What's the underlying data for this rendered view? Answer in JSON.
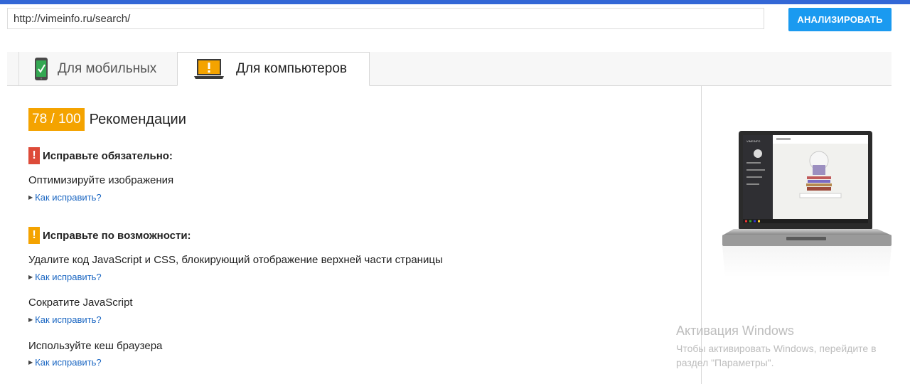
{
  "header": {
    "url_value": "http://vimeinfo.ru/search/",
    "analyze_label": "АНАЛИЗИРОВАТЬ"
  },
  "tabs": [
    {
      "label": "Для мобильных",
      "icon": "mobile-phone-check-icon",
      "active": false
    },
    {
      "label": "Для компьютеров",
      "icon": "desktop-warning-icon",
      "active": true
    }
  ],
  "score": {
    "value": "78 / 100",
    "label": "Рекомендации"
  },
  "sections": {
    "must_fix": {
      "title": "Исправьте обязательно:",
      "icon": "exclamation-icon",
      "rules": [
        {
          "title": "Оптимизируйте изображения",
          "link": "Как исправить?"
        }
      ]
    },
    "should_fix": {
      "title": "Исправьте по возможности:",
      "icon": "exclamation-icon",
      "rules": [
        {
          "title": "Удалите код JavaScript и CSS, блокирующий отображение верхней части страницы",
          "link": "Как исправить?"
        },
        {
          "title": "Сократите JavaScript",
          "link": "Как исправить?"
        },
        {
          "title": "Используйте кеш браузера",
          "link": "Как исправить?"
        }
      ]
    }
  },
  "preview": {
    "icon": "laptop-preview-icon",
    "site_name": "VIMEINFO"
  },
  "watermark": {
    "title": "Активация Windows",
    "line1": "Чтобы активировать Windows, перейдите в",
    "line2": "раздел \"Параметры\"."
  },
  "colors": {
    "accent_blue": "#1a9af0",
    "score_orange": "#f4a300",
    "alert_red": "#dd4b39",
    "link_blue": "#1a66c2"
  }
}
